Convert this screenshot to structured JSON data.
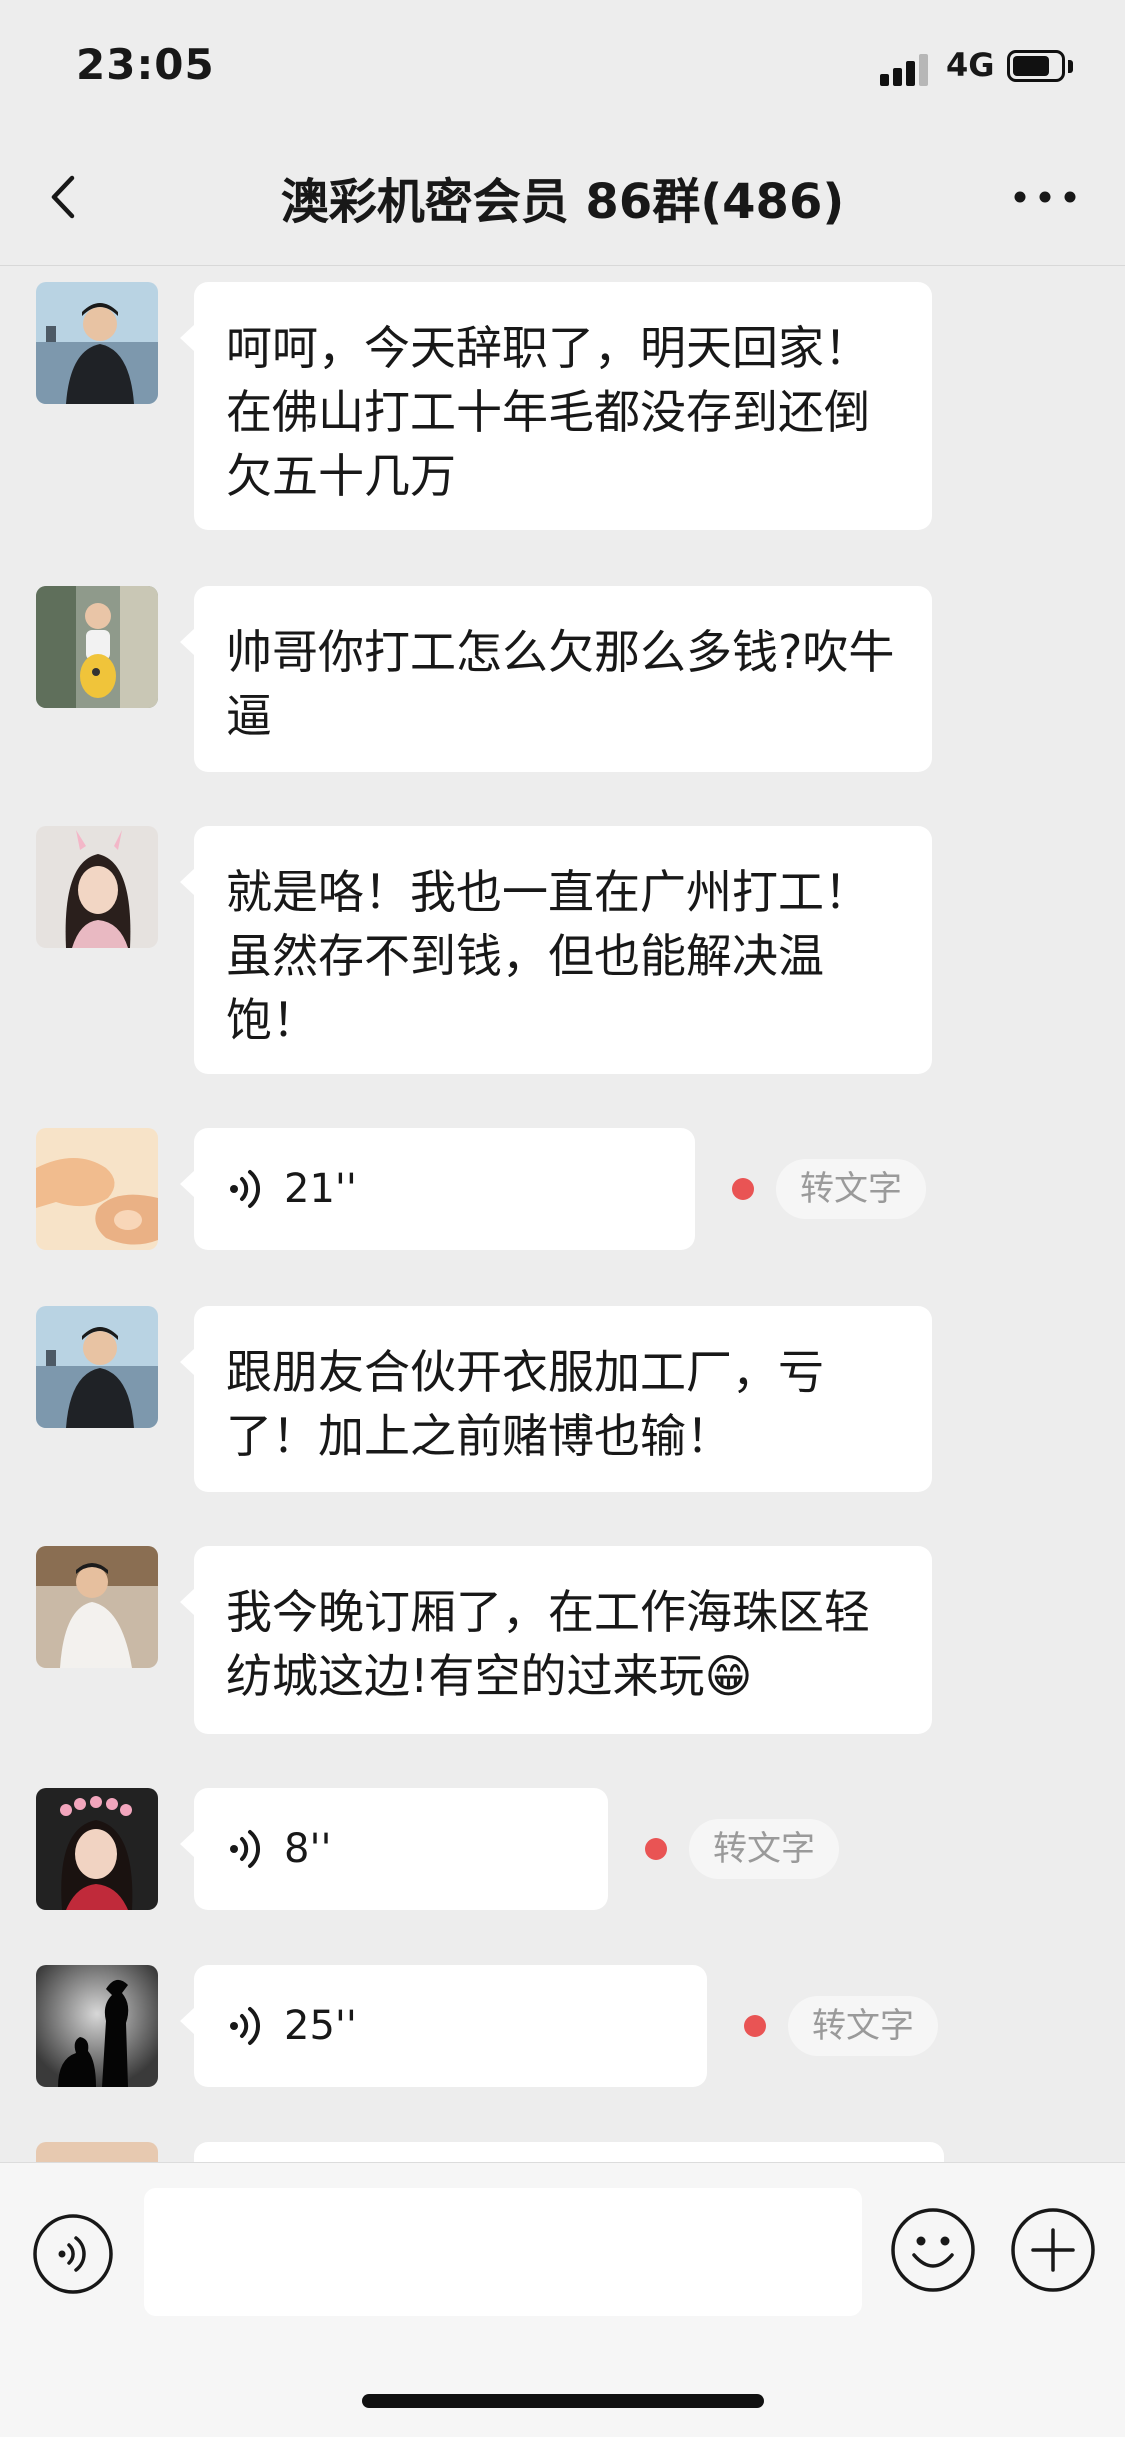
{
  "status_bar": {
    "time": "23:05",
    "network": "4G",
    "battery_level_fraction": 0.7
  },
  "nav": {
    "title": "澳彩机密会员 86群(486)"
  },
  "voice_labels": {
    "to_text": "转文字"
  },
  "messages": [
    {
      "type": "text",
      "avatar": "avatar-photo-man-sea",
      "text": "呵呵，今天辞职了，明天回家！在佛山打工十年毛都没存到还倒欠五十几万"
    },
    {
      "type": "text",
      "avatar": "avatar-photo-child",
      "text": "帅哥你打工怎么欠那么多钱?吹牛逼"
    },
    {
      "type": "text",
      "avatar": "avatar-photo-woman-bunny-ears",
      "text": "就是咯！我也一直在广州打工！虽然存不到钱，但也能解决温饱！"
    },
    {
      "type": "voice",
      "avatar": "avatar-photo-hands",
      "duration": "21''",
      "unread": true
    },
    {
      "type": "text",
      "avatar": "avatar-photo-man-sea",
      "text": "跟朋友合伙开衣服加工厂，亏了！加上之前赌博也输！"
    },
    {
      "type": "text",
      "avatar": "avatar-photo-man-white-shirt",
      "text": "我今晚订厢了，在工作海珠区轻纺城这边!有空的过来玩😁"
    },
    {
      "type": "voice",
      "avatar": "avatar-photo-woman-flower-crown",
      "duration": "8''",
      "unread": true
    },
    {
      "type": "voice",
      "avatar": "avatar-photo-silhouette",
      "duration": "25''",
      "unread": true
    }
  ],
  "colors": {
    "background": "#ededed",
    "bubble": "#ffffff",
    "unread_dot": "#e95454",
    "input_bar": "#f6f6f6"
  }
}
